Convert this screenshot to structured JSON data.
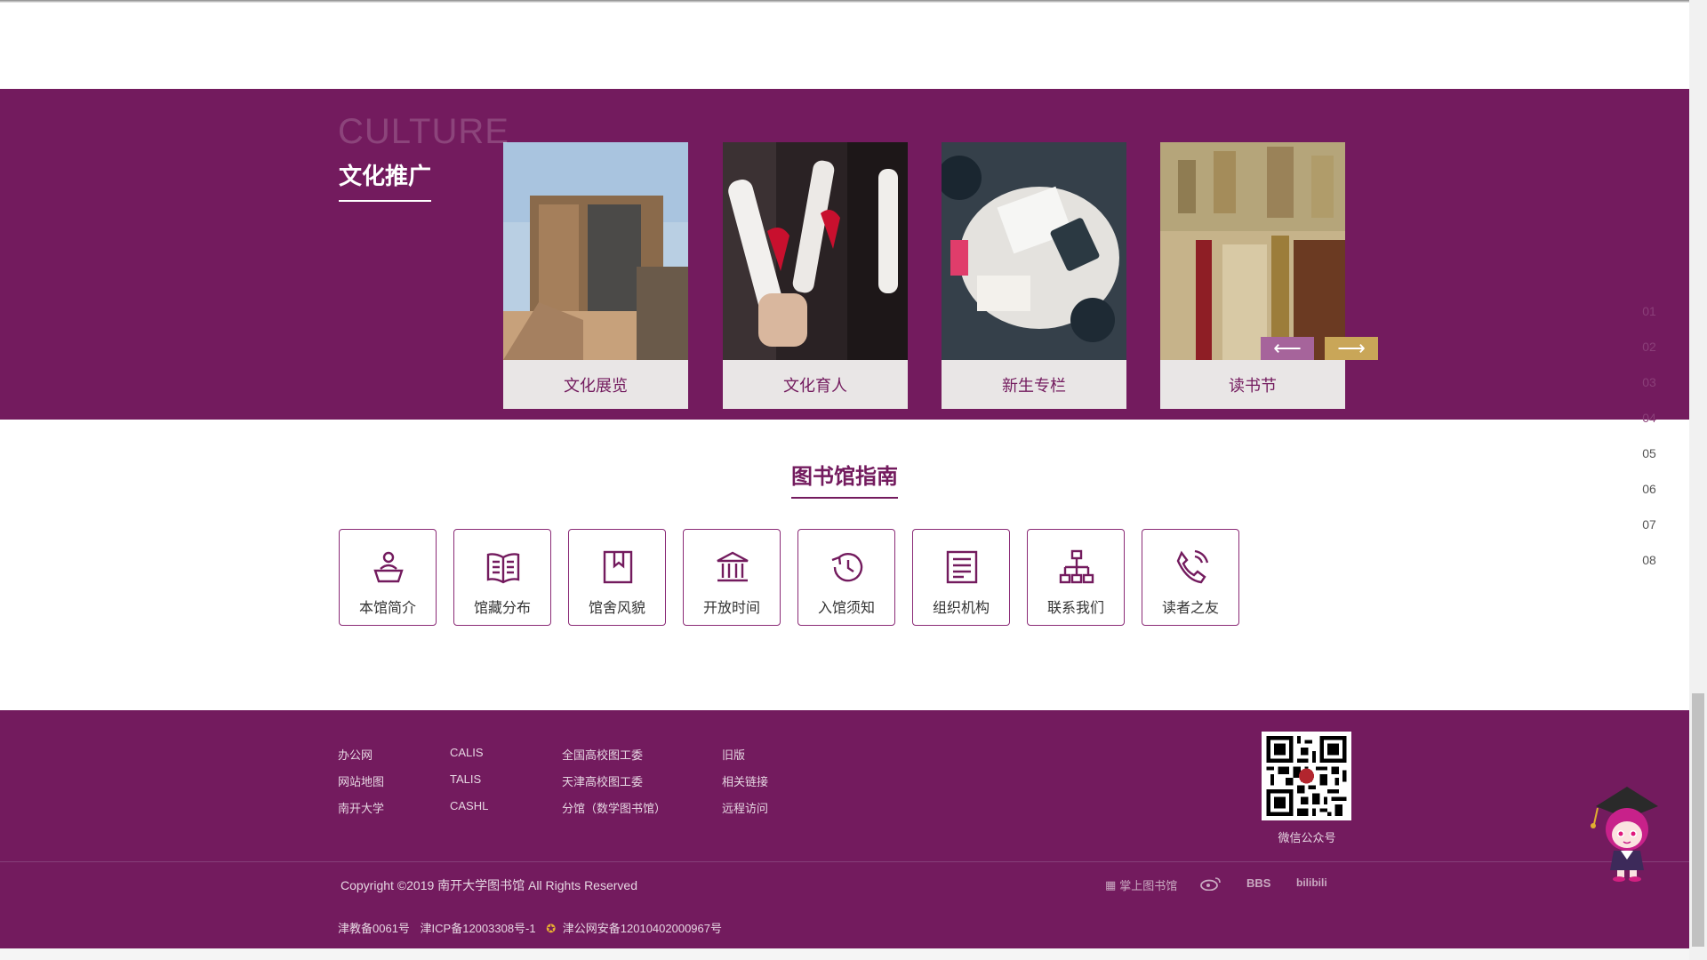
{
  "culture": {
    "en_title": "CULTURE",
    "cn_title": "文化推广",
    "cards": [
      {
        "label": "文化展览"
      },
      {
        "label": "文化育人"
      },
      {
        "label": "新生专栏"
      },
      {
        "label": "读书节"
      }
    ],
    "prev_glyph": "⟵",
    "next_glyph": "⟶"
  },
  "pager": [
    "01",
    "02",
    "03",
    "04",
    "05",
    "06",
    "07",
    "08"
  ],
  "guide": {
    "title": "图书馆指南",
    "items": [
      {
        "label": "本馆简介",
        "icon": "person-desk-icon"
      },
      {
        "label": "馆藏分布",
        "icon": "open-book-icon"
      },
      {
        "label": "馆舍风貌",
        "icon": "bookmark-icon"
      },
      {
        "label": "开放时间",
        "icon": "building-icon"
      },
      {
        "label": "入馆须知",
        "icon": "clock-icon"
      },
      {
        "label": "组织机构",
        "icon": "document-icon"
      },
      {
        "label": "联系我们",
        "icon": "org-chart-icon"
      },
      {
        "label": "读者之友",
        "icon": "phone-icon"
      }
    ]
  },
  "footer": {
    "links": [
      [
        "办公网",
        "网站地图",
        "南开大学"
      ],
      [
        "CALIS",
        "TALIS",
        "CASHL"
      ],
      [
        "全国高校图工委",
        "天津高校图工委",
        "分馆（数学图书馆）"
      ],
      [
        "旧版",
        "相关链接",
        "远程访问"
      ]
    ],
    "qr_label": "微信公众号",
    "copyright": "Copyright ©2019 南开大学图书馆 All Rights Reserved",
    "beian1": "津教备0061号",
    "beian2": "津ICP备12003308号-1",
    "beian3": "津公网安备12010402000967号",
    "social": {
      "mobile_library": "掌上图书馆",
      "bbs": "BBS",
      "bilibili": "bilibili"
    }
  },
  "colors": {
    "brand": "#731b5e",
    "accent_gold": "#c9a658",
    "arrow_prev": "#a6649b"
  }
}
